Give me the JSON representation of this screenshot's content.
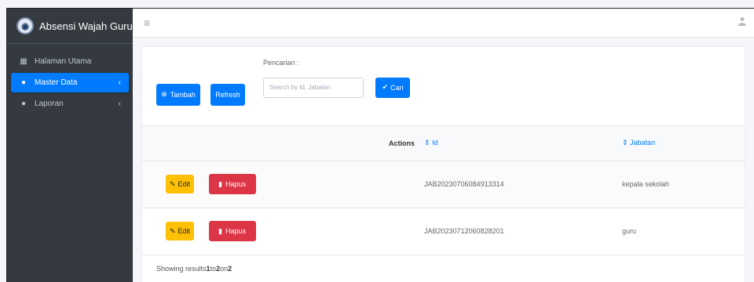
{
  "brand": {
    "title": "Absensi Wajah Guru"
  },
  "sidebar": {
    "items": [
      {
        "label": "Halaman Utama",
        "icon": "home-icon"
      },
      {
        "label": "Master Data",
        "icon": "database-icon",
        "chevron": "‹"
      },
      {
        "label": "Laporan",
        "icon": "database-icon",
        "chevron": "‹"
      }
    ]
  },
  "topbar": {
    "menu_icon": "≡",
    "user_icon": "👤"
  },
  "toolbar": {
    "add_label": "Tambah",
    "refresh_label": "Refresh",
    "search_label": "Pencarian :",
    "search_placeholder": "Search by Id, Jabatan",
    "search_button": "Cari"
  },
  "table": {
    "headers": {
      "actions": "Actions",
      "id": "⇕ Id",
      "jabatan": "⇕ Jabatan"
    },
    "rows": [
      {
        "edit": "Edit",
        "delete": "Hapus",
        "id": "JAB20230706084913314",
        "jabatan": "kepala sekolah"
      },
      {
        "edit": "Edit",
        "delete": "Hapus",
        "id": "JAB20230712060828201",
        "jabatan": "guru"
      }
    ]
  },
  "footer": {
    "prefix": "Showing results ",
    "from": "1",
    "to_word": " to ",
    "to": "2",
    "on_word": " on ",
    "total": "2"
  },
  "colors": {
    "primary": "#007bff",
    "warning": "#ffc107",
    "danger": "#dc3545",
    "sidebar": "#343a40"
  }
}
